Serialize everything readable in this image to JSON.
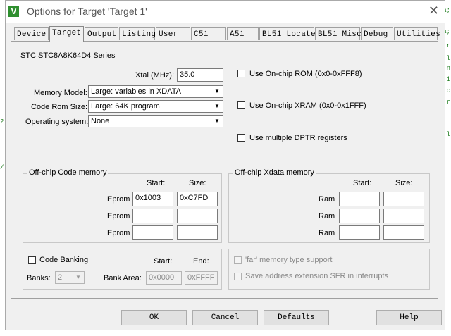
{
  "dialog": {
    "title": "Options for Target 'Target 1'",
    "icon": "keil-uvision-icon"
  },
  "tabs": [
    "Device",
    "Target",
    "Output",
    "Listing",
    "User",
    "C51",
    "A51",
    "BL51 Locate",
    "BL51 Misc",
    "Debug",
    "Utilities"
  ],
  "target": {
    "device": "STC STC8A8K64D4 Series",
    "xtal_label": "Xtal (MHz):",
    "xtal_value": "35.0",
    "memory_model_label": "Memory Model:",
    "memory_model_value": "Large: variables in XDATA",
    "code_rom_label": "Code Rom Size:",
    "code_rom_value": "Large: 64K program",
    "os_label": "Operating system:",
    "os_value": "None",
    "use_onchip_rom": "Use On-chip ROM (0x0-0xFFF8)",
    "use_onchip_xram": "Use On-chip XRAM (0x0-0x1FFF)",
    "use_multiple_dptr": "Use multiple DPTR registers"
  },
  "code_memory": {
    "title": "Off-chip Code memory",
    "start_header": "Start:",
    "size_header": "Size:",
    "rows": [
      {
        "label": "Eprom",
        "start": "0x1003",
        "size": "0xC7FD"
      },
      {
        "label": "Eprom",
        "start": "",
        "size": ""
      },
      {
        "label": "Eprom",
        "start": "",
        "size": ""
      }
    ]
  },
  "xdata_memory": {
    "title": "Off-chip Xdata memory",
    "start_header": "Start:",
    "size_header": "Size:",
    "rows": [
      {
        "label": "Ram",
        "start": "",
        "size": ""
      },
      {
        "label": "Ram",
        "start": "",
        "size": ""
      },
      {
        "label": "Ram",
        "start": "",
        "size": ""
      }
    ]
  },
  "banking": {
    "code_banking": "Code Banking",
    "start_header": "Start:",
    "end_header": "End:",
    "banks_label": "Banks:",
    "banks_value": "2",
    "bank_area_label": "Bank Area:",
    "bank_area_start": "0x0000",
    "bank_area_end": "0xFFFF"
  },
  "far_options": {
    "far_memory": "'far' memory type support",
    "save_sfr": "Save address extension SFR in interrupts"
  },
  "buttons": {
    "ok": "OK",
    "cancel": "Cancel",
    "defaults": "Defaults",
    "help": "Help"
  },
  "background": {
    "right_fragments": [
      "a;",
      "a;",
      "r",
      "l",
      "n",
      "i",
      "c",
      "r",
      "l"
    ],
    "left_fragments": [
      "2;",
      "/"
    ]
  },
  "colors": {
    "title_icon": "#2f8f2f",
    "dialog_bg": "#f0f0f0",
    "code_text": "#1a7a1a"
  }
}
